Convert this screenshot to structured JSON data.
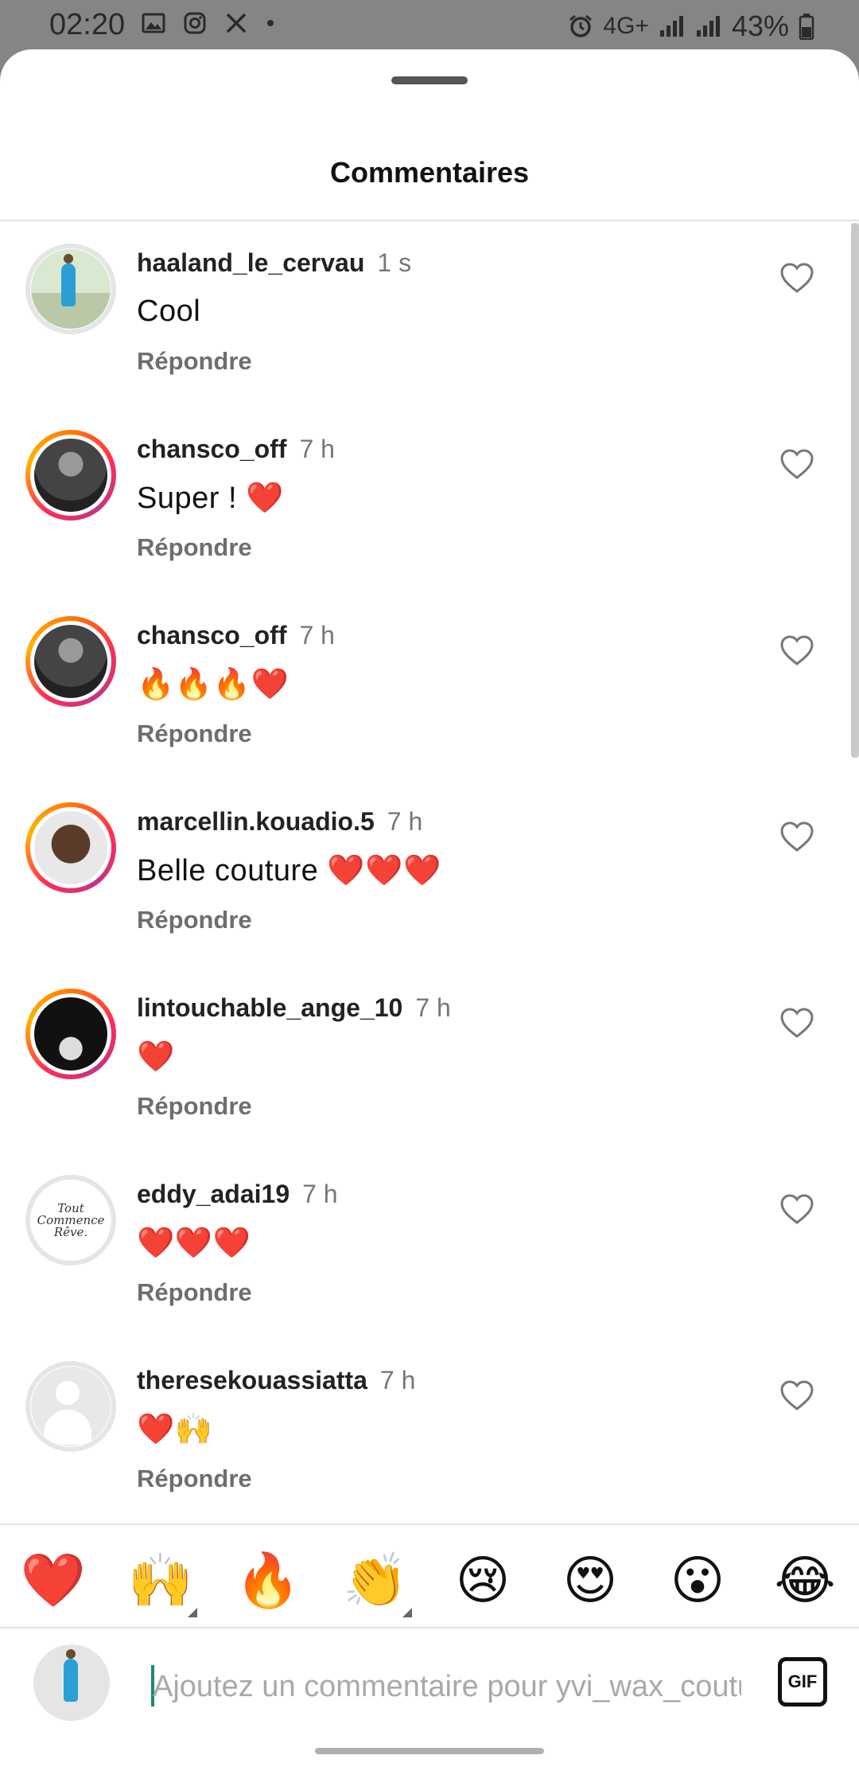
{
  "status_bar": {
    "time": "02:20",
    "network": "4G+",
    "battery": "43%",
    "left_icons": [
      "image-icon",
      "instagram-icon",
      "x-icon",
      "dot-icon"
    ],
    "right_icons": [
      "alarm-icon",
      "signal-icon",
      "signal-icon",
      "battery-icon"
    ]
  },
  "sheet": {
    "title": "Commentaires"
  },
  "comments": [
    {
      "username": "haaland_le_cervau",
      "time": "1 s",
      "text": "Cool",
      "reply": "Répondre",
      "avatar": "field-photo",
      "story_ring": false
    },
    {
      "username": "chansco_off",
      "time": "7 h",
      "text": "Super ! ❤️",
      "reply": "Répondre",
      "avatar": "dark-photo",
      "story_ring": true
    },
    {
      "username": "chansco_off",
      "time": "7 h",
      "text": "🔥🔥🔥❤️",
      "reply": "Répondre",
      "avatar": "dark-photo",
      "story_ring": true
    },
    {
      "username": "marcellin.kouadio.5",
      "time": "7 h",
      "text": "Belle couture ❤️❤️❤️",
      "reply": "Répondre",
      "avatar": "face-photo",
      "story_ring": true
    },
    {
      "username": "lintouchable_ange_10",
      "time": "7 h",
      "text": "❤️",
      "reply": "Répondre",
      "avatar": "black-photo",
      "story_ring": true
    },
    {
      "username": "eddy_adai19",
      "time": "7 h",
      "text": "❤️❤️❤️",
      "reply": "Répondre",
      "avatar": "logo",
      "avatar_text": "Tout Commence Rêve.",
      "story_ring": false
    },
    {
      "username": "theresekouassiatta",
      "time": "7 h",
      "text": "❤️🙌",
      "reply": "Répondre",
      "avatar": "default",
      "story_ring": false
    }
  ],
  "quick_reactions": [
    "❤️",
    "🙌",
    "🔥",
    "👏",
    "😢",
    "😍",
    "😮",
    "😂"
  ],
  "composer": {
    "placeholder": "Ajoutez un commentaire pour yvi_wax_couture...",
    "gif_label": "GIF"
  },
  "colors": {
    "accent_cursor": "#1c8a73",
    "story_ring": "#ff2d55",
    "username": "#222222",
    "secondary_text": "#6e6e6e"
  }
}
